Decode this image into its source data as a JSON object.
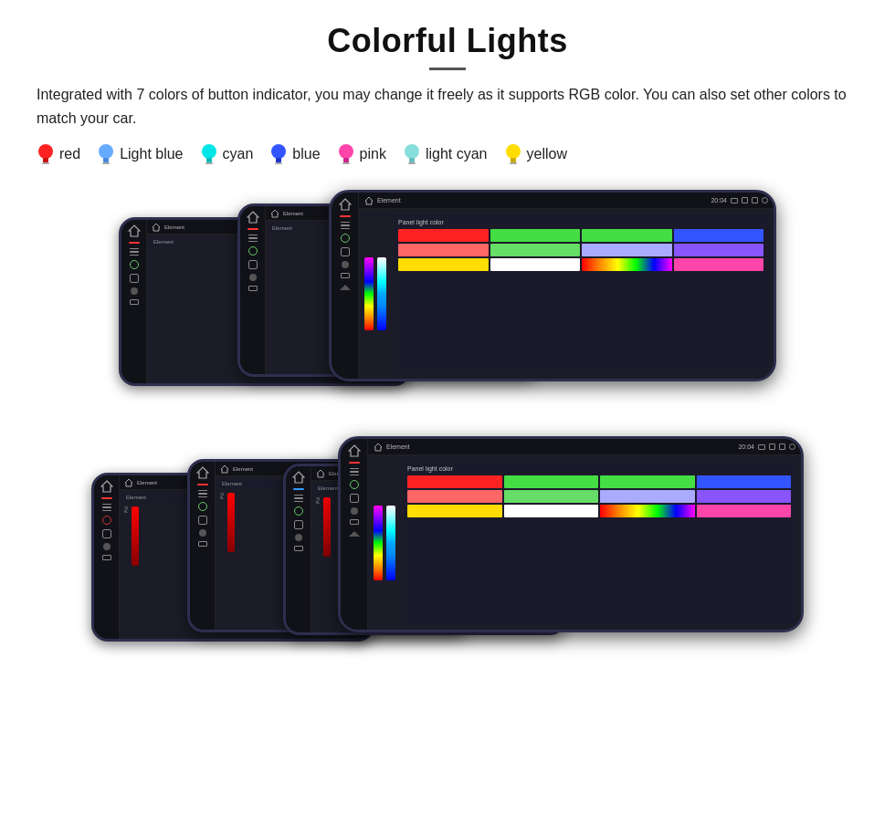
{
  "page": {
    "title": "Colorful Lights",
    "description": "Integrated with 7 colors of button indicator, you may change it freely as it supports RGB color. You can also set other colors to match your car.",
    "colors": [
      {
        "name": "red",
        "hex": "#ff2222",
        "bulbType": "bulb-red"
      },
      {
        "name": "Light blue",
        "hex": "#66aaff",
        "bulbType": "bulb-lightblue"
      },
      {
        "name": "cyan",
        "hex": "#00e5e5",
        "bulbType": "bulb-cyan"
      },
      {
        "name": "blue",
        "hex": "#3355ff",
        "bulbType": "bulb-blue"
      },
      {
        "name": "pink",
        "hex": "#ff44aa",
        "bulbType": "bulb-pink"
      },
      {
        "name": "light cyan",
        "hex": "#88dddd",
        "bulbType": "bulb-lightcyan"
      },
      {
        "name": "yellow",
        "hex": "#ffdd00",
        "bulbType": "bulb-yellow"
      }
    ],
    "divider_text": "—"
  },
  "device_ui": {
    "topbar_title": "Element",
    "topbar_time": "20:04",
    "panel_light_color_label": "Panel light color",
    "element_label": "Element"
  }
}
